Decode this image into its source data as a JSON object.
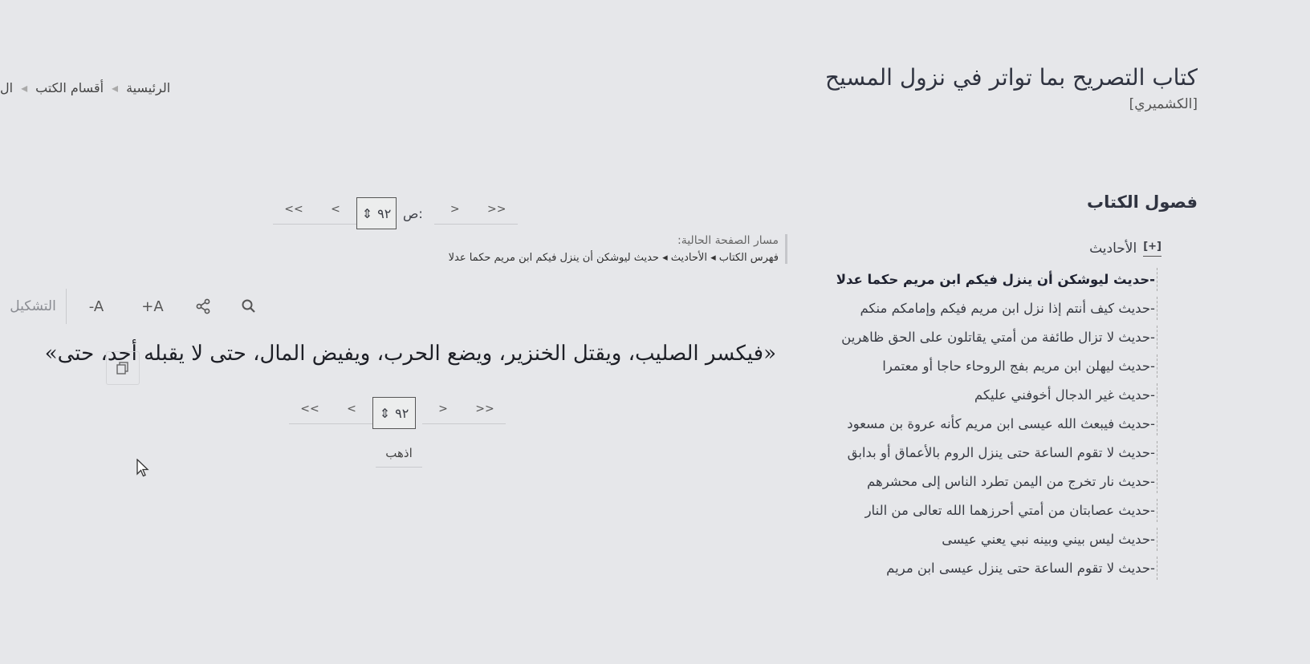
{
  "header": {
    "title": "كتاب التصريح بما تواتر في نزول المسيح",
    "author": "[الكشميري]"
  },
  "breadcrumb": {
    "items": [
      "الرئيسية",
      "أقسام الكتب",
      "ال"
    ]
  },
  "sidebar": {
    "heading": "فصول الكتاب",
    "section": {
      "toggle": "[+]",
      "label": "الأحاديث"
    },
    "items": [
      {
        "label": "-حديث ليوشكن أن ينزل فيكم ابن مريم حكما عدلا"
      },
      {
        "label": "-حديث كيف أنتم إذا نزل ابن مريم فيكم وإمامكم منكم"
      },
      {
        "label": "-حديث لا تزال طائفة من أمتي يقاتلون على الحق ظاهرين"
      },
      {
        "label": "-حديث ليهلن ابن مريم بفج الروحاء حاجا أو معتمرا"
      },
      {
        "label": "-حديث غير الدجال أخوفني عليكم"
      },
      {
        "label": "-حديث فيبعث الله عيسى ابن مريم كأنه عروة بن مسعود"
      },
      {
        "label": "-حديث لا تقوم الساعة حتى ينزل الروم بالأعماق أو بدابق"
      },
      {
        "label": "-حديث نار تخرج من اليمن تطرد الناس إلى محشرهم"
      },
      {
        "label": "-حديث عصابتان من أمتي أحرزهما الله تعالى من النار"
      },
      {
        "label": "-حديث ليس بيني وبينه نبي يعني عيسى"
      },
      {
        "label": "-حديث لا تقوم الساعة حتى ينزل عيسى ابن مريم"
      }
    ]
  },
  "pager": {
    "first": "<<",
    "prev": "<",
    "next": ">",
    "last": ">>",
    "page_label": "ص:",
    "page_value": "٩٢",
    "go_label": "اذهب"
  },
  "path": {
    "label": "مسار الصفحة الحالية:",
    "crumbs": "فهرس الكتاب ◂ الأحاديث ◂ حديث ليوشكن أن ينزل فيكم ابن مريم حكما عدلا"
  },
  "toolbar": {
    "tashkeel": "التشكيل",
    "font_decrease": "-A",
    "font_increase": "+A",
    "icons": [
      "share-icon",
      "search-icon",
      "copy-icon"
    ]
  },
  "content": {
    "text": "«فيكسر الصليب، ويقتل الخنزير، ويضع الحرب، ويفيض المال، حتى لا يقبله أحد، حتى»"
  }
}
